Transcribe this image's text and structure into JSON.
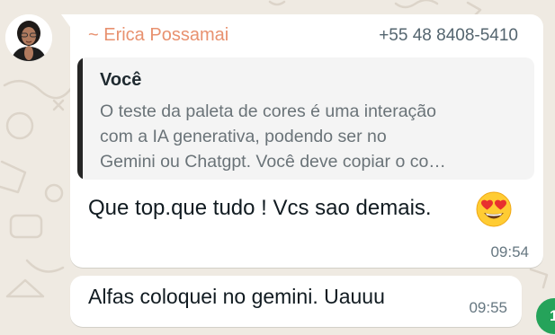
{
  "chat": {
    "message_1": {
      "sender_name": "~ Erica Possamai",
      "sender_phone": "+55 48 8408-5410",
      "quote_author": "Você",
      "quote_text": "O teste da paleta de cores é uma interação\ncom a IA generativa, podendo ser no\nGemini ou Chatgpt. Você deve copiar o co…",
      "text": "Que top.que tudo ! Vcs sao demais.",
      "emoji": "smiling-face-with-heart-eyes",
      "time": "09:54"
    },
    "message_2": {
      "text": "Alfas coloquei no gemini. Uauuu",
      "time": "09:55"
    },
    "fab_glyph": "1"
  },
  "colors": {
    "wallpaper": "#efeae2",
    "bubble": "#ffffff",
    "sender_name": "#e8916f",
    "quote_bar": "#252525",
    "fab": "#25a35a"
  }
}
